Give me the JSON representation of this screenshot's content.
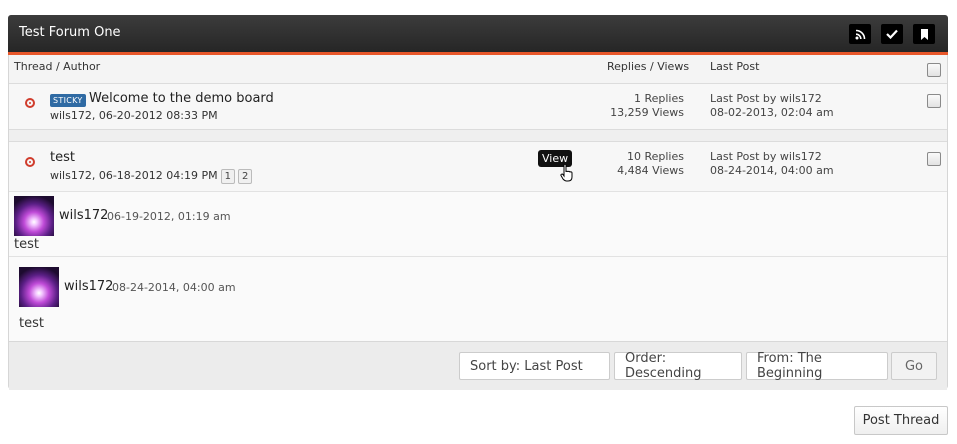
{
  "forum": {
    "title": "Test Forum One",
    "icons": [
      "rss-icon",
      "check-icon",
      "bookmark-icon"
    ]
  },
  "columns": {
    "thread_author": "Thread / Author",
    "replies_views": "Replies / Views",
    "last_post": "Last Post"
  },
  "threads": [
    {
      "badge": "STICKY",
      "title": "Welcome to the demo board",
      "author_date": "wils172, 06-20-2012 08:33 PM",
      "replies": "1 Replies",
      "views": "13,259 Views",
      "last_post_by": "Last Post by wils172",
      "last_post_date": "08-02-2013, 02:04 am"
    },
    {
      "title": "test",
      "author_date": "wils172, 06-18-2012 04:19 PM",
      "pages": [
        "1",
        "2"
      ],
      "tooltip": "View",
      "replies": "10 Replies",
      "views": "4,484 Views",
      "last_post_by": "Last Post by wils172",
      "last_post_date": "08-24-2014, 04:00 am"
    }
  ],
  "previews": [
    {
      "user": "wils172",
      "date": "06-19-2012, 01:19 am",
      "text": "test"
    },
    {
      "user": "wils172",
      "date": "08-24-2014, 04:00 am",
      "text": "test"
    }
  ],
  "controls": {
    "sort": "Sort by: Last Post",
    "order": "Order: Descending",
    "from": "From: The Beginning",
    "go": "Go"
  },
  "post_thread": "Post Thread"
}
